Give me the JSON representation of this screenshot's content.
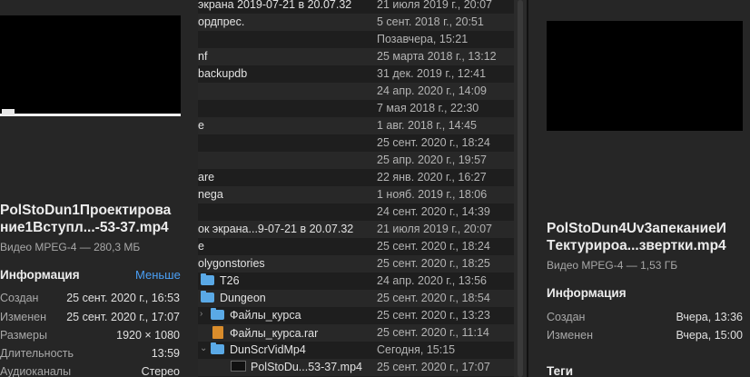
{
  "left": {
    "file_name_line1": "PolStoDun1Проектирова",
    "file_name_line2": "ние1Вступл...-53-37.mp4",
    "file_type": "Видео MPEG-4 — 280,3 МБ",
    "info_title": "Информация",
    "less_label": "Меньше",
    "info": [
      {
        "key": "Создан",
        "value": "25 сент. 2020 г., 16:53"
      },
      {
        "key": "Изменен",
        "value": "25 сент. 2020 г., 17:07"
      },
      {
        "key": "Размеры",
        "value": "1920 × 1080"
      },
      {
        "key": "Длительность",
        "value": "13:59"
      },
      {
        "key": "Аудиоканалы",
        "value": "Стерео"
      }
    ]
  },
  "list": {
    "rows": [
      {
        "name": "экрана 2019-07-21 в 20.07.32",
        "date": "21 июля 2019 г., 20:07"
      },
      {
        "name": "ордпрес.",
        "date": "5 сент. 2018 г., 20:51"
      },
      {
        "name": "",
        "date": "Позавчера, 15:21"
      },
      {
        "name": "nf",
        "date": "25 марта 2018 г., 13:12"
      },
      {
        "name": "backupdb",
        "date": "31 дек. 2019 г., 12:41"
      },
      {
        "name": "",
        "date": "24 апр. 2020 г., 14:09"
      },
      {
        "name": "",
        "date": "7 мая 2018 г., 22:30"
      },
      {
        "name": "e",
        "date": "1 авг. 2018 г., 14:45"
      },
      {
        "name": "",
        "date": "25 сент. 2020 г., 18:24"
      },
      {
        "name": "",
        "date": "25 апр. 2020 г., 19:57"
      },
      {
        "name": "are",
        "date": "22 янв. 2020 г., 16:27"
      },
      {
        "name": "nega",
        "date": "1 нояб. 2019 г., 18:06"
      },
      {
        "name": "",
        "date": "24 сент. 2020 г., 14:39"
      },
      {
        "name": "ок экрана...9-07-21 в 20.07.32",
        "date": "21 июля 2019 г., 20:07"
      },
      {
        "name": "e",
        "date": "25 сент. 2020 г., 18:24"
      },
      {
        "name": "olygonstories",
        "date": "25 сент. 2020 г., 18:25"
      },
      {
        "name": "T26",
        "date": "24 апр. 2020 г., 13:56"
      },
      {
        "name": "Dungeon",
        "date": "25 сент. 2020 г., 18:54"
      },
      {
        "name": "Файлы_курса",
        "date": "25 сент. 2020 г., 13:23"
      },
      {
        "name": "Файлы_курса.rar",
        "date": "25 сент. 2020 г., 11:14"
      },
      {
        "name": "DunScrVidMp4",
        "date": "Сегодня, 15:15"
      },
      {
        "name": "PolStoDu...53-37.mp4",
        "date": "25 сент. 2020 г., 17:07"
      }
    ]
  },
  "right": {
    "file_name_line1": "PolStoDun4Uv3апеканиеИ",
    "file_name_line2": "Tектуриpoa...звертки.mp4",
    "file_type": "Видео MPEG-4 — 1,53 ГБ",
    "info_title": "Информация",
    "info": [
      {
        "key": "Создан",
        "value": "Вчера, 13:36"
      },
      {
        "key": "Изменен",
        "value": "Вчера, 15:00"
      }
    ],
    "tags_title": "Теги"
  }
}
